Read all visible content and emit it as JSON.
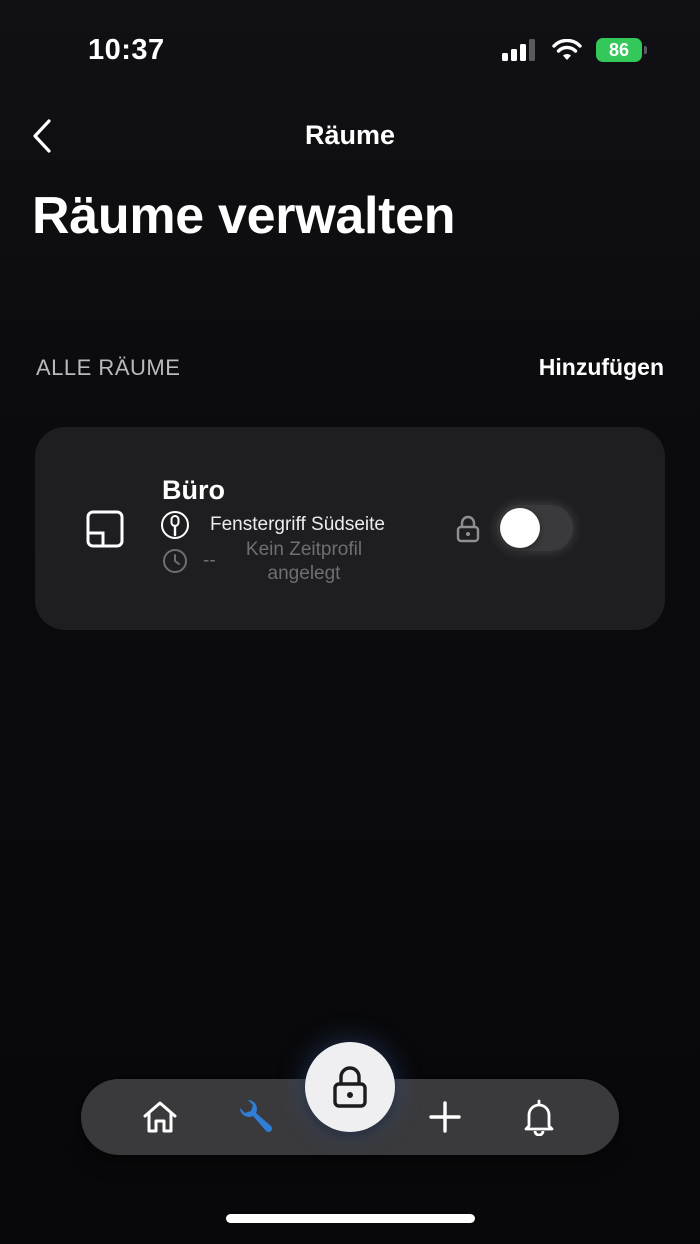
{
  "status_bar": {
    "time": "10:37",
    "battery_level": "86"
  },
  "nav": {
    "title": "Räume"
  },
  "page": {
    "title": "Räume verwalten"
  },
  "section": {
    "label": "ALLE RÄUME",
    "add_label": "Hinzufügen"
  },
  "rooms": [
    {
      "name": "Büro",
      "device": "Fenstergriff Südseite",
      "schedule_dash": "--",
      "schedule_text": "Kein Zeitprofil angelegt",
      "toggle_on": false
    }
  ],
  "tab_bar": {
    "items": [
      "home-icon",
      "wrench-icon",
      "lock-icon",
      "plus-icon",
      "bell-icon"
    ],
    "active": "wrench-icon"
  },
  "colors": {
    "background": "#0b0b0d",
    "card": "#1e1e20",
    "accent_blue": "#2f7fd6",
    "battery_green": "#34c759",
    "muted_text": "#6e6e73"
  }
}
